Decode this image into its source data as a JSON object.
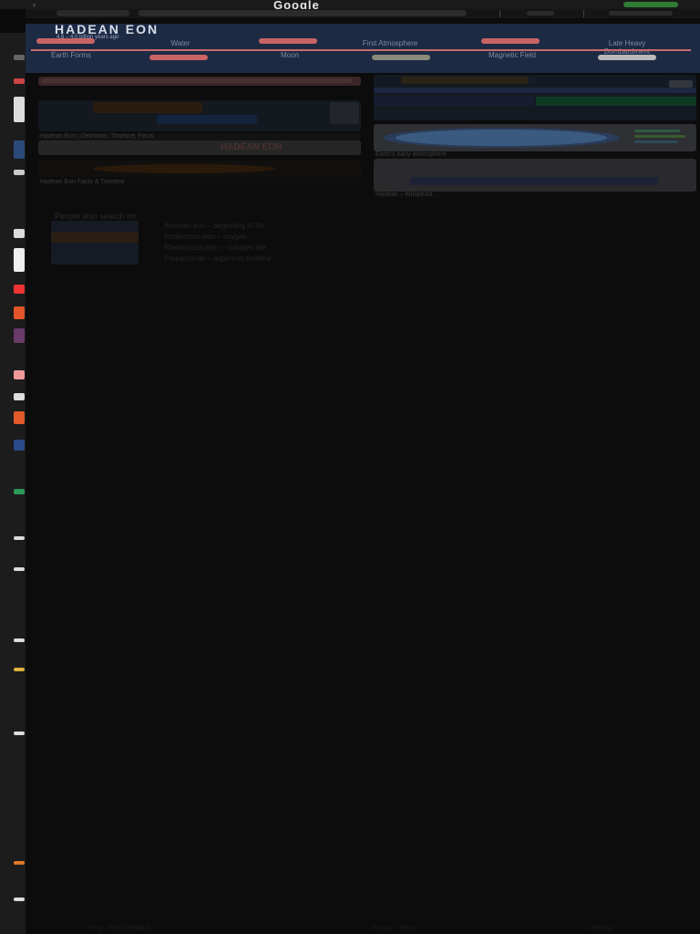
{
  "browser": {
    "back_label": "‹",
    "brand": "Google",
    "tab_label": "",
    "address": ""
  },
  "banner": {
    "title": "HADEAN EON",
    "subtitle": "4.6 – 4.0 billion years ago",
    "categories": [
      {
        "label": "Water"
      },
      {
        "label": "Moon"
      },
      {
        "label": "First Atmosphere"
      },
      {
        "label": "Magnetic Field"
      },
      {
        "label": "Late Heavy Bombardment"
      },
      {
        "label": "Earth Forms"
      }
    ],
    "colors": {
      "accent": "#c96464",
      "bg": "#1d2a44"
    }
  },
  "results": {
    "card_a_caption": "Hadean Eon | Definition, Timeline, Facts",
    "card_b_caption": "HADEAN EON",
    "card_c_caption": "Hadean Eon Facts & Timeline",
    "card_d_caption": "Earth's early atmosphere",
    "card_e_caption": "Hadean – Wikipedia"
  },
  "section": {
    "title": "People also search for",
    "items": [
      "Archean eon – beginning of life",
      "Proterozoic eon – oxygen",
      "Phanerozoic eon – complex life",
      "Precambrian – supereon timeline"
    ]
  },
  "footer": {
    "left": "Help · Send feedback",
    "mid": "Privacy · Terms",
    "right": "Settings"
  }
}
